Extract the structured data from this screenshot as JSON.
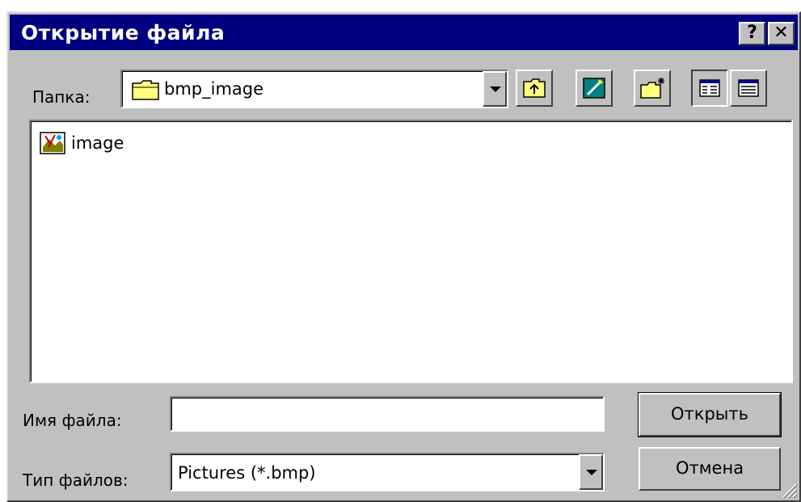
{
  "window": {
    "title": "Открытие файла",
    "help_label": "?",
    "close_label": "✕"
  },
  "toolbar": {
    "folder_label": "Папка:",
    "folder_value": "bmp_image",
    "icons": [
      "up-folder-icon",
      "desktop-icon",
      "new-folder-icon",
      "list-view-icon",
      "details-view-icon"
    ]
  },
  "file_list": {
    "items": [
      {
        "name": "image",
        "icon": "image-file-icon"
      }
    ]
  },
  "filename": {
    "label": "Имя файла:",
    "value": ""
  },
  "filetype": {
    "label": "Тип файлов:",
    "value": "Pictures (*.bmp)"
  },
  "buttons": {
    "open": "Открыть",
    "cancel": "Отмена"
  },
  "colors": {
    "titlebar": "#000080",
    "face": "#c0c0c0",
    "field": "#ffffff"
  }
}
